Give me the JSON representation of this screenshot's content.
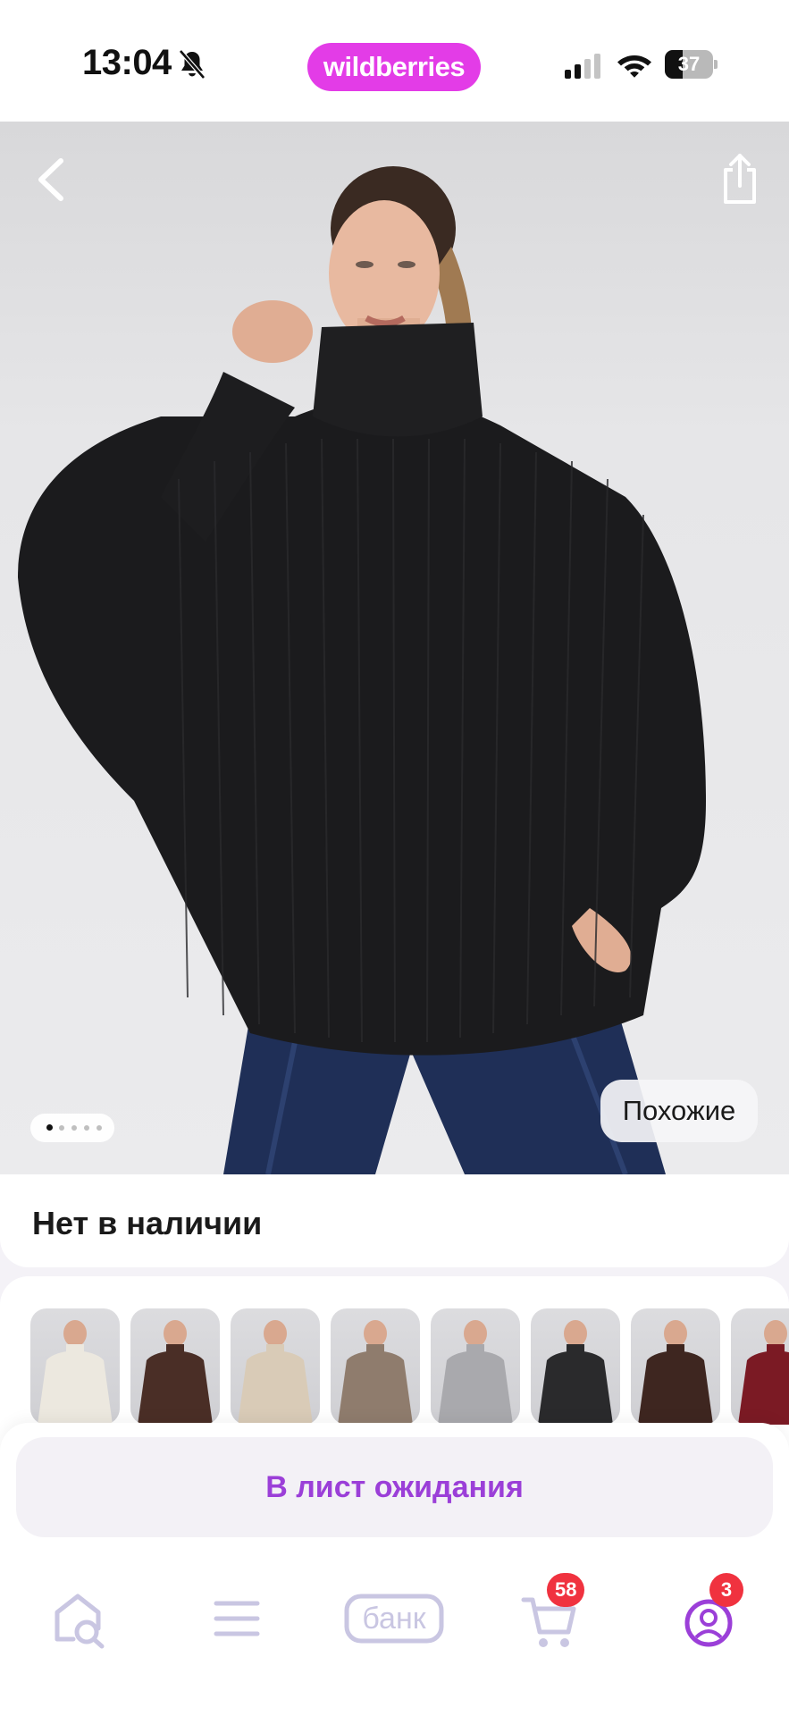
{
  "status_bar": {
    "time": "13:04",
    "brand": "wildberries",
    "battery_level": "37",
    "battery_fraction": 0.37
  },
  "colors": {
    "brand_pill": "#e33ce7",
    "waitlist_text": "#9b3fd8",
    "badge": "#f0323f",
    "nav_icon": "#c9c6e2",
    "profile_icon": "#9b3fd8"
  },
  "product": {
    "carousel": {
      "total": 5,
      "active": 1
    },
    "similar_label": "Похожие",
    "availability": "Нет в наличии"
  },
  "variants": [
    {
      "label": "cream sweater",
      "color": "#ece8df"
    },
    {
      "label": "dark brown sweater",
      "color": "#4a2e26"
    },
    {
      "label": "beige turtleneck",
      "color": "#d9cbb7"
    },
    {
      "label": "taupe sweater",
      "color": "#8f7c6d"
    },
    {
      "label": "grey turtleneck",
      "color": "#a9a9ad"
    },
    {
      "label": "black sweater",
      "color": "#2a2a2c"
    },
    {
      "label": "chocolate turtleneck",
      "color": "#3e2620"
    },
    {
      "label": "burgundy sweater",
      "color": "#7b1a24"
    }
  ],
  "waitlist_button": "В лист ожидания",
  "nav": {
    "home_icon": "home-search-icon",
    "catalog_icon": "menu-icon",
    "bank_label": "банк",
    "cart_icon": "cart-icon",
    "cart_badge": "58",
    "profile_icon": "profile-icon",
    "profile_badge": "3"
  }
}
